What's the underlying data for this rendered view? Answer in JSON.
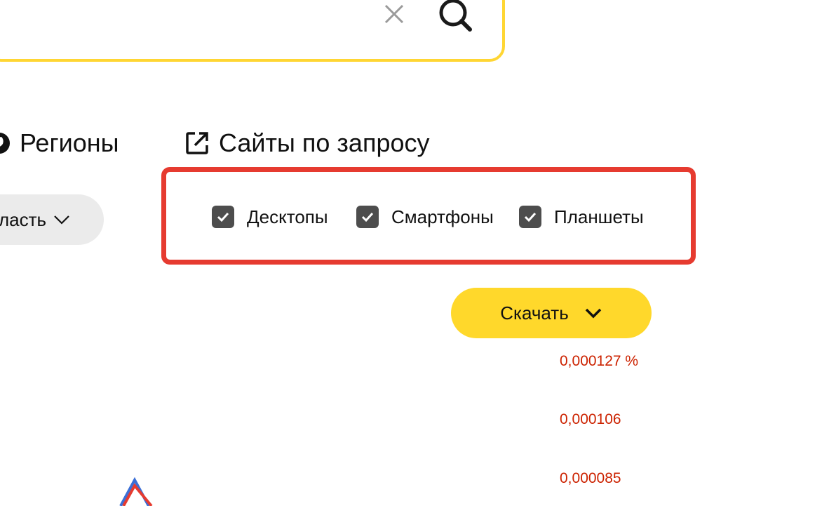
{
  "search": {
    "value": "",
    "clear_icon": "close-icon",
    "search_icon": "search-icon"
  },
  "tabs": [
    {
      "label": "Регионы",
      "icon": "globe-icon"
    },
    {
      "label": "Сайты по запросу",
      "icon": "external-link-icon"
    }
  ],
  "region_dropdown": {
    "label": "ласть"
  },
  "devices": [
    {
      "label": "Десктопы",
      "checked": true
    },
    {
      "label": "Смартфоны",
      "checked": true
    },
    {
      "label": "Планшеты",
      "checked": true
    }
  ],
  "download": {
    "label": "Скачать"
  },
  "chart_axis": {
    "labels": [
      "0,000127 %",
      "0,000106",
      "0,000085"
    ]
  },
  "colors": {
    "accent_yellow": "#ffd82b",
    "highlight_red": "#e63b30",
    "axis_label_red": "#cc2200",
    "series_blue": "#3b6fd6",
    "series_red": "#e63b30"
  }
}
